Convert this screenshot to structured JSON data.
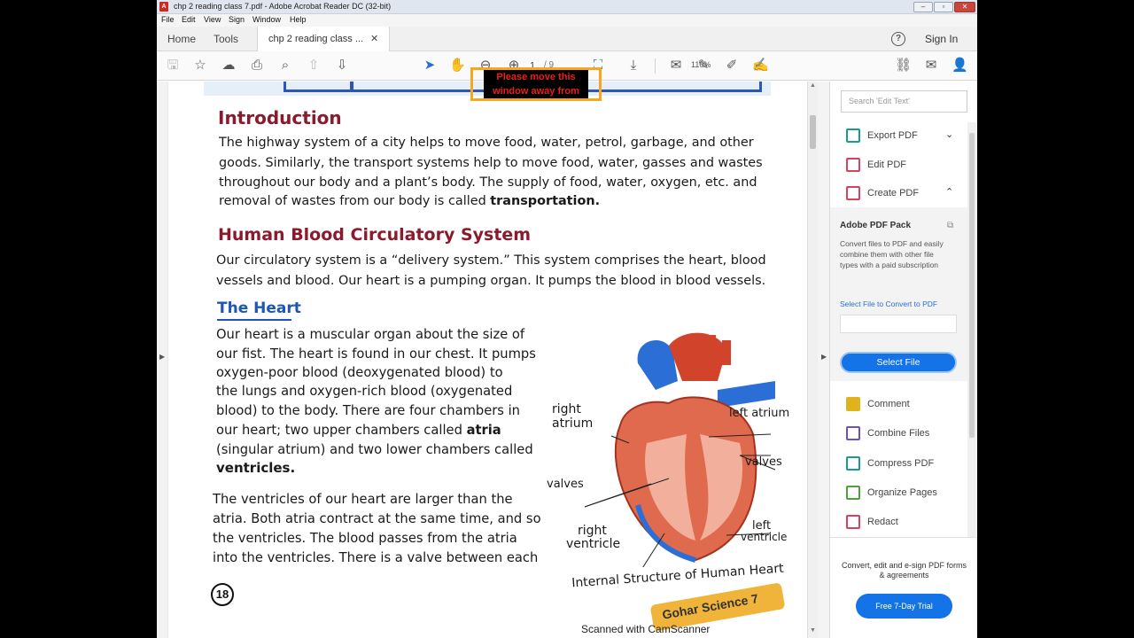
{
  "window": {
    "title": "chp 2 reading class 7.pdf - Adobe Acrobat Reader DC (32-bit)",
    "controls": [
      "–",
      "▫",
      "✕"
    ]
  },
  "menu": [
    "File",
    "Edit",
    "View",
    "Sign",
    "Window",
    "Help"
  ],
  "tabs": {
    "home": "Home",
    "tools": "Tools",
    "document": "chp 2 reading class ...",
    "close": "✕"
  },
  "header": {
    "help": "?",
    "signin": "Sign In"
  },
  "toolbar": {
    "page_current": "1",
    "page_total": "/ 9",
    "zoom": "110%"
  },
  "notice": {
    "text_line1": "Please move this",
    "text_line2": "window away from"
  },
  "document": {
    "intro_title": "Introduction",
    "intro_lines": [
      "The highway system of a city helps to move food, water, petrol, garbage, and other",
      "goods. Similarly, the transport systems help to move food, water, gasses and wastes",
      "throughout our body and a plant’s body. The supply of food, water, oxygen, etc. and",
      "removal of wastes from our body is called "
    ],
    "intro_bold": "transportation.",
    "circ_title": "Human Blood Circulatory System",
    "circ_lines": [
      "Our circulatory system is a “delivery system.” This system comprises the heart, blood",
      "vessels and blood. Our heart is a pumping organ. It pumps the blood in blood vessels."
    ],
    "heart_title": "The Heart",
    "heart_lines": [
      "Our heart is a muscular organ about the size of",
      "our fist. The heart is found in our chest. It pumps",
      "oxygen-poor blood (deoxygenated blood) to",
      "the lungs and oxygen-rich blood (oxygenated",
      "blood) to the body. There are four chambers in",
      "our heart; two upper chambers called ",
      "(singular atrium) and two lower chambers called"
    ],
    "heart_bold_atria": "atria",
    "heart_bold_ventricles": "ventricles.",
    "vent_lines": [
      "The ventricles of our heart are larger than the",
      "atria. Both atria contract at the same time, and so",
      "the ventricles. The blood passes from the atria",
      "into the ventricles. There is a valve between each"
    ],
    "page_number": "18",
    "figure_labels": {
      "right_atrium_1": "right",
      "right_atrium_2": "atrium",
      "left_atrium": "left atrium",
      "valves_left": "valves",
      "valves_right": "valves",
      "right_ventricle_1": "right",
      "right_ventricle_2": "ventricle",
      "left_ventricle_1": "left",
      "left_ventricle_2": "ventricle"
    },
    "figure_caption": "Internal Structure of Human Heart",
    "publisher": "Gohar Science 7",
    "scanner_note": "Scanned with CamScanner"
  },
  "right_panel": {
    "search_placeholder": "Search 'Edit Text'",
    "tools": [
      {
        "label": "Export PDF",
        "color": "#1a9c8c"
      },
      {
        "label": "Edit PDF",
        "color": "#d8415b"
      },
      {
        "label": "Create PDF",
        "color": "#d8415b"
      }
    ],
    "pack_title": "Adobe PDF Pack",
    "pack_desc": "Convert files to PDF and easily combine them with other file types with a paid subscription",
    "pack_link": "Select File to Convert to PDF",
    "pack_button": "Select File",
    "more_tools": [
      {
        "label": "Comment",
        "color": "#e0b21c"
      },
      {
        "label": "Combine Files",
        "color": "#6b4fd1"
      },
      {
        "label": "Compress PDF",
        "color": "#1a9c8c"
      },
      {
        "label": "Organize Pages",
        "color": "#4da33a"
      },
      {
        "label": "Redact",
        "color": "#d8415b"
      }
    ],
    "footer_text": "Convert, edit and e-sign PDF forms & agreements",
    "trial_button": "Free 7-Day Trial"
  }
}
